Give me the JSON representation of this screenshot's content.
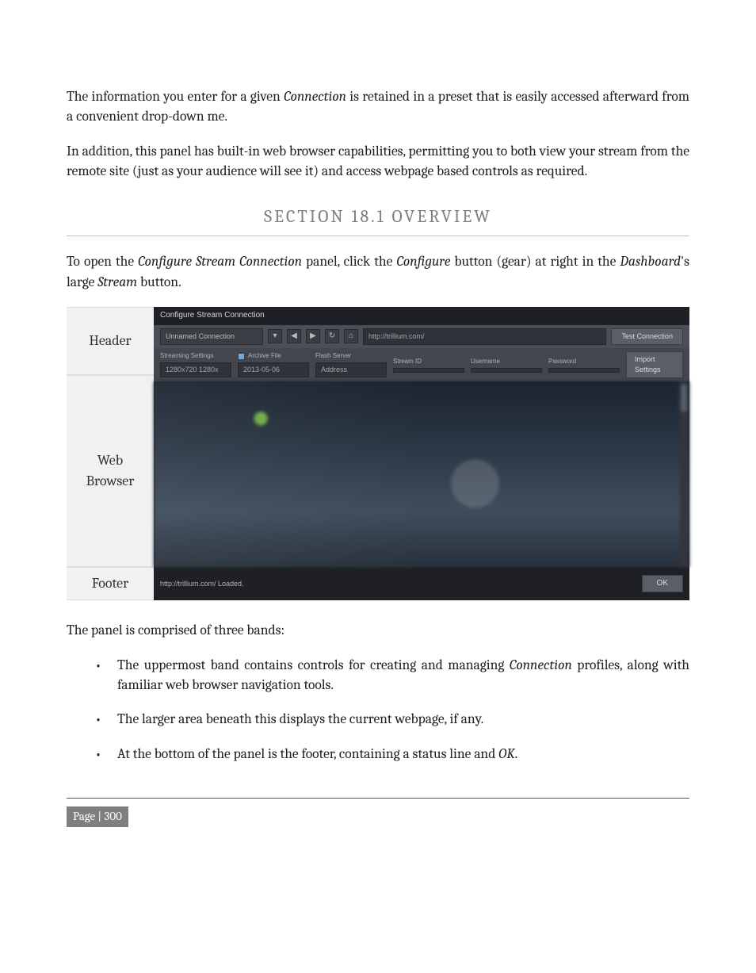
{
  "para1": {
    "pre": "The information you enter for a given ",
    "em": "Connection",
    "post": " is retained in a preset that is easily accessed afterward from a convenient drop-down me."
  },
  "para2": "In addition, this panel has built-in web browser capabilities, permitting you to both view your stream from the remote site (just as your audience will see it) and access webpage based controls as required.",
  "section_title": "SECTION 18.1 OVERVIEW",
  "para3": {
    "a": "To open the ",
    "em1": "Configure Stream Connection",
    "b": " panel, click the ",
    "em2": "Configure",
    "c": " button (gear) at right in the ",
    "em3": "Dashboard",
    "d": "'s large ",
    "em4": "Stream",
    "e": " button."
  },
  "fig_labels": {
    "header": "Header",
    "browser": "Web\nBrowser",
    "footer": "Footer"
  },
  "panel": {
    "title": "Configure Stream Connection",
    "connection_name": "Unnamed Connection",
    "url": "http://trillium.com/",
    "test_connection": "Test Connection",
    "streaming_settings_label": "Streaming Settings",
    "resolution": "1280x720 1280x",
    "archive_file_label": "Archive File",
    "archive_date": "2013-05-06",
    "flash_server_label": "Flash Server",
    "address_label": "Address",
    "stream_id_label": "Stream ID",
    "username_label": "Username",
    "password_label": "Password",
    "import_settings": "Import Settings",
    "status": "http://trillium.com/ Loaded.",
    "ok": "OK"
  },
  "para4": "The panel is comprised of three bands:",
  "bullets": {
    "b1": {
      "a": "The uppermost band contains controls for creating and managing ",
      "em": "Connection",
      "b": " profiles, along with familiar web browser navigation tools."
    },
    "b2": "The larger area beneath this displays the current webpage, if any.",
    "b3": {
      "a": "At the bottom of the panel is the footer, containing a status line and ",
      "em": "OK",
      "b": "."
    }
  },
  "page_number": "Page | 300"
}
